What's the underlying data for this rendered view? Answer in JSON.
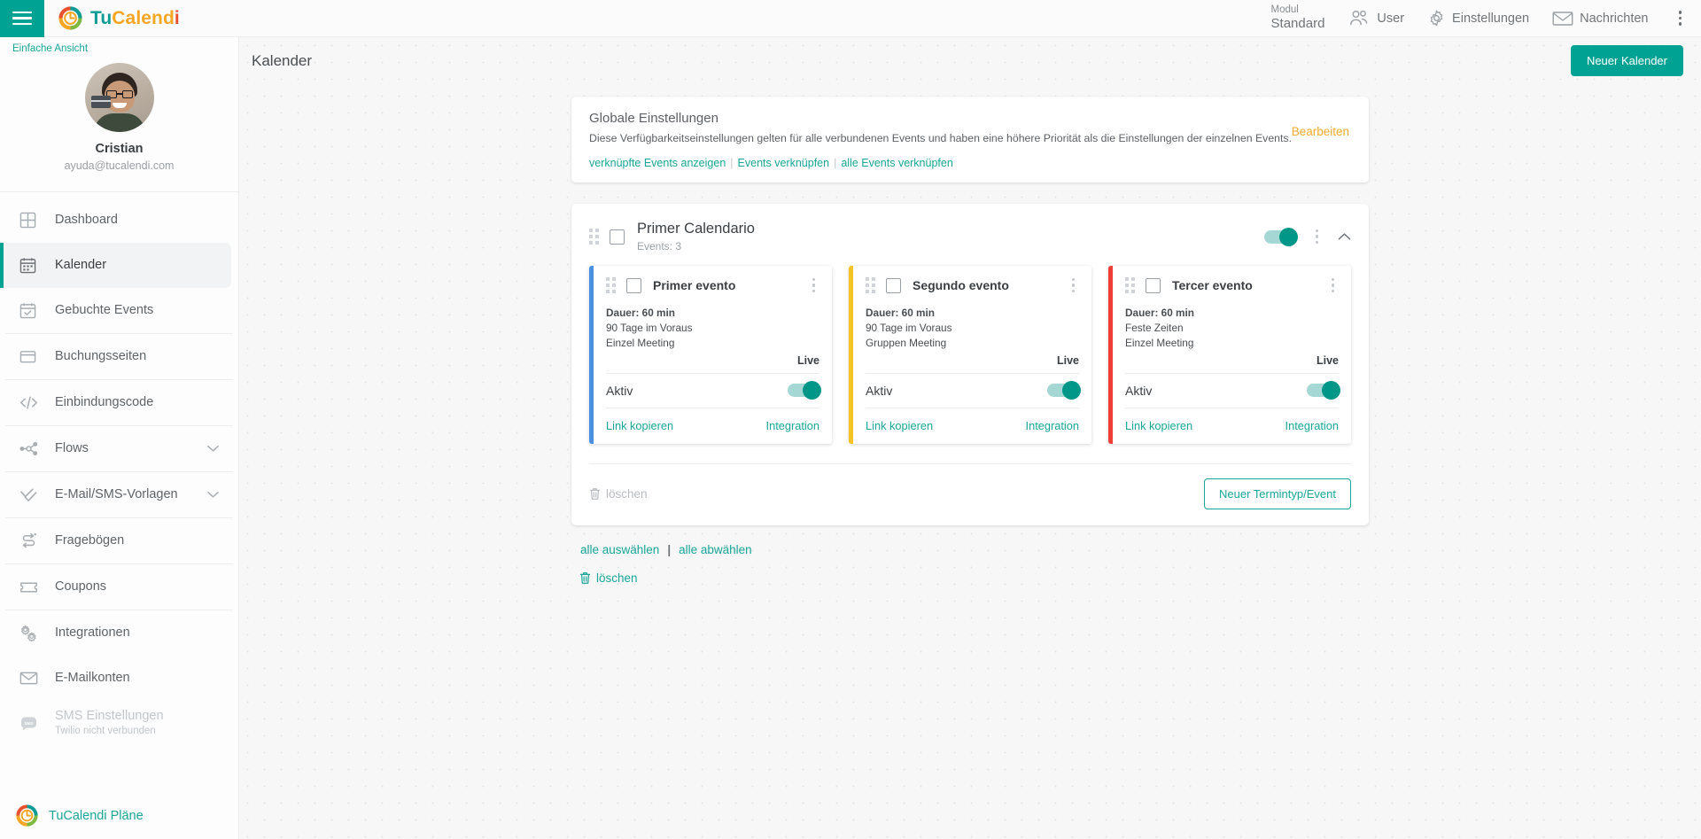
{
  "topbar": {
    "menu_icon": "hamburger-menu-icon",
    "brand": {
      "part1": "Tu",
      "part2": "Calend",
      "part3": "i"
    },
    "modul_label": "Modul",
    "modul_value": "Standard",
    "nav": [
      {
        "label": "User",
        "icon": "users-icon"
      },
      {
        "label": "Einstellungen",
        "icon": "gear-icon"
      },
      {
        "label": "Nachrichten",
        "icon": "envelope-icon"
      }
    ],
    "overflow_icon": "vertical-dots-icon"
  },
  "sidebar": {
    "simple_view": "Einfache Ansicht",
    "profile": {
      "name": "Cristian",
      "email": "ayuda@tucalendi.com"
    },
    "items": [
      {
        "label": "Dashboard",
        "icon": "grid-icon",
        "active": false
      },
      {
        "label": "Kalender",
        "icon": "calendar-icon",
        "active": true
      },
      {
        "label": "Gebuchte Events",
        "icon": "calendar-check-icon",
        "active": false
      },
      {
        "label": "Buchungsseiten",
        "icon": "window-icon",
        "active": false
      },
      {
        "label": "Einbindungscode",
        "icon": "code-icon",
        "active": false
      },
      {
        "label": "Flows",
        "icon": "nodes-icon",
        "active": false,
        "chevron": true
      },
      {
        "label": "E-Mail/SMS-Vorlagen",
        "icon": "double-check-icon",
        "active": false,
        "chevron": true
      },
      {
        "label": "Fragebögen",
        "icon": "survey-arrows-icon",
        "active": false
      },
      {
        "label": "Coupons",
        "icon": "ticket-icon",
        "active": false
      },
      {
        "label": "Integrationen",
        "icon": "gears-icon",
        "active": false
      },
      {
        "label": "E-Mailkonten",
        "icon": "envelope-icon",
        "active": false
      },
      {
        "label": "SMS Einstellungen",
        "sublabel": "Twilio nicht verbunden",
        "icon": "sms-bubble-icon",
        "active": false,
        "disabled": true
      }
    ],
    "plans_label": "TuCalendi Pläne",
    "plans_icon": "tucalendi-logo-icon"
  },
  "page": {
    "title": "Kalender",
    "new_calendar_button": "Neuer Kalender"
  },
  "global_settings": {
    "title": "Globale Einstellungen",
    "description": "Diese Verfügbarkeitseinstellungen gelten für alle verbundenen Events und haben eine höhere Priorität als die Einstellungen der einzelnen Events.",
    "edit_label": "Bearbeiten",
    "links": [
      "verknüpfte Events anzeigen",
      "Events verknüpfen",
      "alle Events verknüpfen"
    ],
    "link_separator": "|"
  },
  "calendar": {
    "name": "Primer Calendario",
    "events_count_label": "Events: 3",
    "enabled": true,
    "collapse_icon": "chevron-up-icon",
    "menu_icon": "vertical-dots-icon",
    "drag_icon": "drag-grip-icon",
    "checkbox_checked": false,
    "events": [
      {
        "name": "Primer evento",
        "duration": "Dauer: 60 min",
        "advance": "90 Tage im Voraus",
        "type": "Einzel Meeting",
        "live_label": "Live",
        "aktiv_label": "Aktiv",
        "aktiv_on": true,
        "copy_link": "Link kopieren",
        "integration": "Integration",
        "accent_color": "#4a90e2"
      },
      {
        "name": "Segundo evento",
        "duration": "Dauer: 60 min",
        "advance": "90 Tage im Voraus",
        "type": "Gruppen Meeting",
        "live_label": "Live",
        "aktiv_label": "Aktiv",
        "aktiv_on": true,
        "copy_link": "Link kopieren",
        "integration": "Integration",
        "accent_color": "#f7c325"
      },
      {
        "name": "Tercer evento",
        "duration": "Dauer: 60 min",
        "advance": "Feste Zeiten",
        "type": "Einzel Meeting",
        "live_label": "Live",
        "aktiv_label": "Aktiv",
        "aktiv_on": true,
        "copy_link": "Link kopieren",
        "integration": "Integration",
        "accent_color": "#ef3e36"
      }
    ],
    "delete_label": "löschen",
    "new_event_button": "Neuer Termintyp/Event"
  },
  "bulk": {
    "select_all": "alle auswählen",
    "deselect_all": "alle abwählen",
    "separator": "|",
    "delete_label": "löschen"
  },
  "colors": {
    "teal": "#00a294",
    "teal_link": "#19a698",
    "amber": "#f0ab2e",
    "event_blue": "#4a90e2",
    "event_yellow": "#f7c325",
    "event_red": "#ef3e36"
  }
}
